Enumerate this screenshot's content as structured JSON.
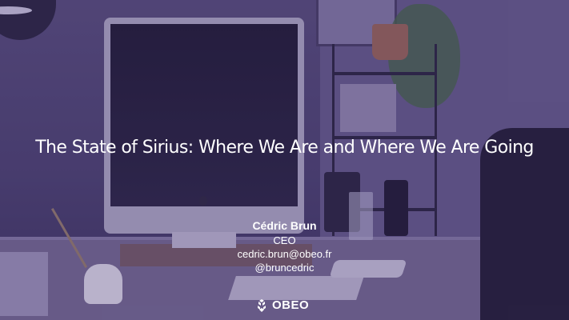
{
  "slide": {
    "title": "The State of Sirius: Where We Are and Where We Are Going",
    "presenter": {
      "name": "Cédric Brun",
      "role": "CEO",
      "email": "cedric.brun@obeo.fr",
      "handle": "@bruncedric"
    },
    "brand": {
      "name": "OBEO",
      "icon": "obeo-logo-icon"
    }
  },
  "colors": {
    "overlay": "#4e4474",
    "text": "#ffffff"
  }
}
